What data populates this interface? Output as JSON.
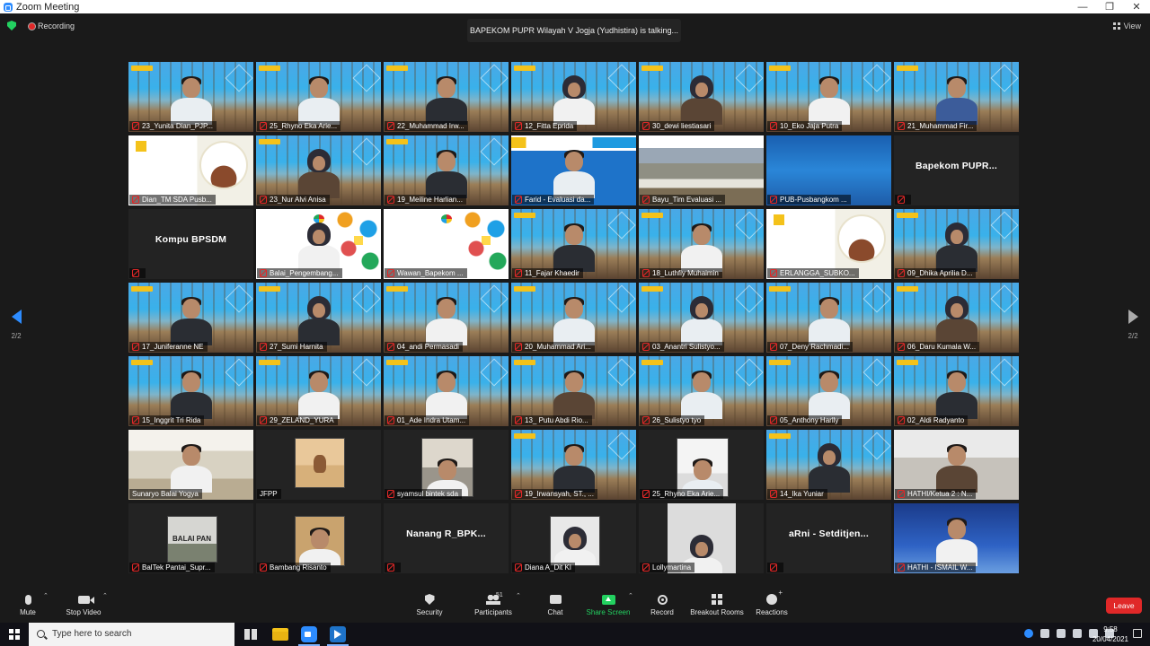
{
  "window": {
    "title": "Zoom Meeting",
    "controls": {
      "minimize": "—",
      "restore": "❐",
      "close": "✕"
    }
  },
  "meeting": {
    "recording_label": "Recording",
    "talking_banner": "BAPEKOM PUPR Wilayah V Jogja (Yudhistira) is talking...",
    "view_label": "View",
    "page_indicator_left": "2/2",
    "page_indicator_right": "2/2"
  },
  "tiles": [
    {
      "name": "23_Yunita Dian_PJP...",
      "bg": "slide",
      "avatar": "avatar light",
      "muted": true
    },
    {
      "name": "25_Rhyno Eka Arie...",
      "bg": "slide",
      "avatar": "avatar light",
      "muted": true
    },
    {
      "name": "22_Muhammad Irw...",
      "bg": "slide",
      "avatar": "avatar",
      "muted": true
    },
    {
      "name": "12_Fitta Eprida",
      "bg": "slide",
      "avatar": "avatar hijab white",
      "muted": true
    },
    {
      "name": "30_dewi liestiasari",
      "bg": "slide",
      "avatar": "avatar hijab brown",
      "muted": true
    },
    {
      "name": "10_Eko Jaja Putra",
      "bg": "slide",
      "avatar": "avatar white",
      "muted": true
    },
    {
      "name": "21_Muhammad Fir...",
      "bg": "slide",
      "avatar": "avatar blue",
      "muted": true
    },
    {
      "name": "Dian_TM SDA Pusb...",
      "bg": "pusbang",
      "muted": true
    },
    {
      "name": "23_Nur Alvi Anisa",
      "bg": "slide",
      "avatar": "avatar hijab brown",
      "muted": true
    },
    {
      "name": "19_Meiline Harlian...",
      "bg": "slide",
      "avatar": "avatar",
      "muted": true
    },
    {
      "name": "Farid - Evaluasi da...",
      "bg": "evals",
      "avatar": "avatar light",
      "muted": true
    },
    {
      "name": "Bayu_Tim Evaluasi ...",
      "bg": "bendung",
      "muted": true
    },
    {
      "name": "PUB-Pusbangkom ...",
      "bg": "ilsblue",
      "muted": true
    },
    {
      "name": "",
      "bg": "plain",
      "center": "Bapekom  PUPR...",
      "muted": true
    },
    {
      "name": "",
      "bg": "plain",
      "center": "Kompu BPSDM",
      "muted": true
    },
    {
      "name": "Balai_Pengembang...",
      "bg": "balai",
      "avatar": "avatar hijab white",
      "muted": true
    },
    {
      "name": "Wawan_Bapekom ...",
      "bg": "balai",
      "muted": true
    },
    {
      "name": "11_Fajar Khaedir",
      "bg": "slide",
      "avatar": "avatar",
      "muted": true
    },
    {
      "name": "18_Luthfiy Muhaimin",
      "bg": "slide",
      "avatar": "avatar white",
      "muted": true
    },
    {
      "name": "ERLANGGA_SUBKO...",
      "bg": "pusbang",
      "muted": true
    },
    {
      "name": "09_Dhika Aprilia D...",
      "bg": "slide",
      "avatar": "avatar hijab",
      "muted": true
    },
    {
      "name": "17_Juniferanne NE",
      "bg": "slide",
      "avatar": "avatar",
      "muted": true
    },
    {
      "name": "27_Sumi Harnita",
      "bg": "slide",
      "avatar": "avatar hijab",
      "muted": true
    },
    {
      "name": "04_andi Permasadi",
      "bg": "slide",
      "avatar": "avatar white",
      "muted": true
    },
    {
      "name": "20_Muhammad Ari...",
      "bg": "slide",
      "avatar": "avatar light",
      "muted": true
    },
    {
      "name": "03_Anantri Sulistyo...",
      "bg": "slide",
      "avatar": "avatar hijab light",
      "muted": true
    },
    {
      "name": "07_Deny Rachmadi...",
      "bg": "slide",
      "avatar": "avatar light",
      "muted": true
    },
    {
      "name": "06_Daru Kumala W...",
      "bg": "slide",
      "avatar": "avatar hijab brown",
      "muted": true
    },
    {
      "name": "15_Inggrit Tri Rida",
      "bg": "slide",
      "avatar": "avatar",
      "muted": true
    },
    {
      "name": "29_ZELAND_YURA",
      "bg": "slide",
      "avatar": "avatar white",
      "muted": true
    },
    {
      "name": "01_Ade Indra Utam...",
      "bg": "slide",
      "avatar": "avatar white",
      "muted": true
    },
    {
      "name": "13_ Putu Abdi Rio...",
      "bg": "slide",
      "avatar": "avatar brown",
      "muted": true
    },
    {
      "name": "26_Sulistyo tyo",
      "bg": "slide",
      "avatar": "avatar light",
      "muted": true
    },
    {
      "name": "05_Anthony Harlly",
      "bg": "slide",
      "avatar": "avatar light",
      "muted": true
    },
    {
      "name": "02_Aldi Radyanto",
      "bg": "slide",
      "avatar": "avatar",
      "muted": true
    },
    {
      "name": "Sunaryo Balai Yogya",
      "bg": "office",
      "avatar": "avatar white",
      "muted": false
    },
    {
      "name": "JFPP",
      "bg": "plain",
      "thumb": "jfpp",
      "muted": false
    },
    {
      "name": "syamsul bintek sda",
      "bg": "plain",
      "thumb": "syam",
      "muted": true
    },
    {
      "name": "19_Irwansyah, ST., ...",
      "bg": "slide",
      "avatar": "avatar",
      "muted": true
    },
    {
      "name": "25_Rhyno Eka Arie...",
      "bg": "plain",
      "thumb": "rhyno",
      "muted": true
    },
    {
      "name": "14_Ika Yuniar",
      "bg": "slide",
      "avatar": "avatar hijab",
      "muted": true
    },
    {
      "name": "HATHI/Ketua 2 : N...",
      "bg": "room",
      "avatar": "avatar brown",
      "muted": true
    },
    {
      "name": "BalTek Pantai_Supr...",
      "bg": "plain",
      "thumb": "balai2",
      "thumb_text": "BALAI PAN",
      "muted": true
    },
    {
      "name": "Bambang Risanto",
      "bg": "plain",
      "thumb": "bamb",
      "muted": true
    },
    {
      "name": "",
      "bg": "plain",
      "center": "Nanang  R_BPK...",
      "muted": true
    },
    {
      "name": "Diana A_Dit KI",
      "bg": "plain",
      "thumb": "diana",
      "muted": true
    },
    {
      "name": "Lollymartina",
      "bg": "plain",
      "thumb": "lolly",
      "muted": true
    },
    {
      "name": "",
      "bg": "plain",
      "center": "aRni -  Setditjen...",
      "muted": true
    },
    {
      "name": "HATHI - ISMAIL W...",
      "bg": "blueprof",
      "avatar": "avatar white",
      "muted": true
    }
  ],
  "toolbar": {
    "mute": "Mute",
    "stop_video": "Stop Video",
    "security": "Security",
    "participants": "Participants",
    "participants_count": "51",
    "chat": "Chat",
    "share_screen": "Share Screen",
    "record": "Record",
    "breakout_rooms": "Breakout Rooms",
    "reactions": "Reactions",
    "leave": "Leave"
  },
  "taskbar": {
    "search_placeholder": "Type here to search",
    "time": "9:58",
    "date": "20/04/2021"
  },
  "colors": {
    "accent": "#2d8cff",
    "share_green": "#23d160",
    "leave_red": "#e02828",
    "background": "#1a1a1a"
  }
}
